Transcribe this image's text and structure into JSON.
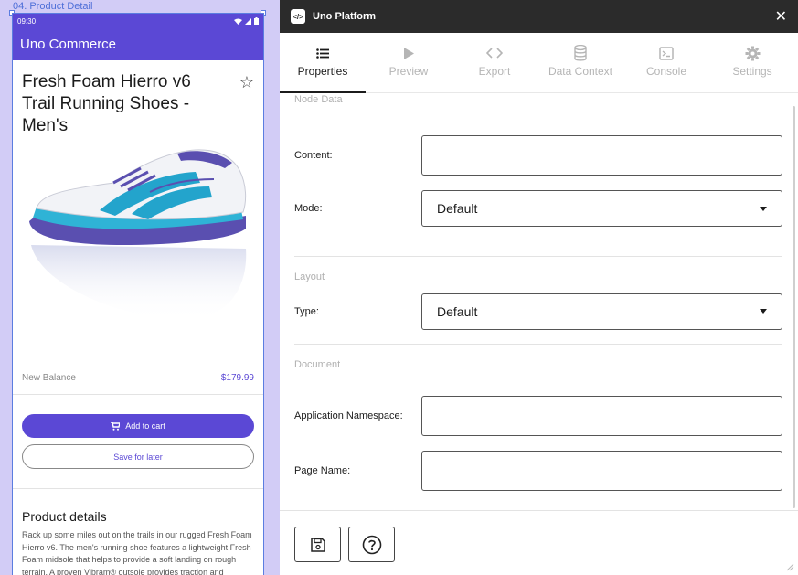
{
  "frame": {
    "label": "04. Product Detail"
  },
  "device": {
    "time": "09:30",
    "app_title": "Uno Commerce",
    "product": {
      "title": "Fresh Foam Hierro v6 Trail Running Shoes - Men's",
      "brand": "New Balance",
      "price": "$179.99",
      "add_to_cart": "Add to cart",
      "save_for_later": "Save for later",
      "details_title": "Product details",
      "details_text": "Rack up some miles out on the trails in our rugged Fresh Foam Hierro v6. The men's running shoe features a lightweight Fresh Foam midsole that helps to provide a soft landing on rough terrain. A proven Vibram® outsole provides traction and durability."
    },
    "colors": {
      "primary": "#5b48d5"
    }
  },
  "tool": {
    "title": "Uno Platform",
    "tabs": [
      {
        "label": "Properties",
        "icon": "list-icon",
        "active": true
      },
      {
        "label": "Preview",
        "icon": "play-icon",
        "active": false
      },
      {
        "label": "Export",
        "icon": "code-icon",
        "active": false
      },
      {
        "label": "Data Context",
        "icon": "database-icon",
        "active": false
      },
      {
        "label": "Console",
        "icon": "terminal-icon",
        "active": false
      },
      {
        "label": "Settings",
        "icon": "gear-icon",
        "active": false
      }
    ],
    "sections": {
      "node_data": {
        "title": "Node Data",
        "content_label": "Content:",
        "content_value": "",
        "mode_label": "Mode:",
        "mode_value": "Default"
      },
      "layout": {
        "title": "Layout",
        "type_label": "Type:",
        "type_value": "Default"
      },
      "document": {
        "title": "Document",
        "namespace_label": "Application Namespace:",
        "namespace_value": "",
        "page_name_label": "Page Name:",
        "page_name_value": ""
      }
    },
    "footer": {
      "save_icon": "save-icon",
      "help_icon": "help-icon"
    }
  }
}
